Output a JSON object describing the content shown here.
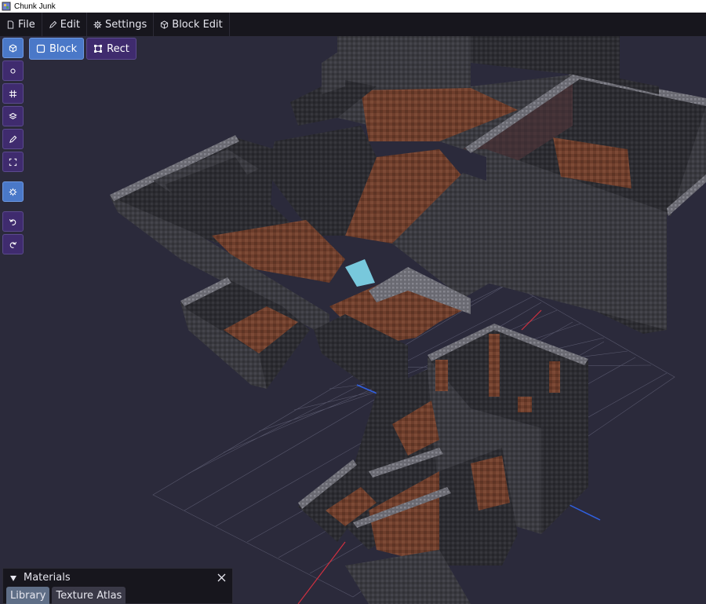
{
  "window": {
    "title": "Chunk Junk"
  },
  "menu": [
    {
      "label": "File",
      "icon": "file-icon"
    },
    {
      "label": "Edit",
      "icon": "pencil-icon"
    },
    {
      "label": "Settings",
      "icon": "gear-icon"
    },
    {
      "label": "Block Edit",
      "icon": "cube-icon"
    }
  ],
  "modes": {
    "block": "Block",
    "rect": "Rect"
  },
  "tools": [
    "cube-icon",
    "circle-icon",
    "grid-icon",
    "layers-icon",
    "pencil-icon",
    "select-icon",
    "gear-icon",
    "undo-icon",
    "redo-icon"
  ],
  "panel": {
    "title": "Materials",
    "tabs": [
      "Library",
      "Texture Atlas"
    ]
  },
  "colors": {
    "background": "#2b2a3b",
    "menubar": "#17161d",
    "tool_purple": "#3f2b6e",
    "tool_active": "#4a78c8",
    "wall": "#3a3a40",
    "floor": "#6e3e2c",
    "grid": "#6a6a80"
  }
}
